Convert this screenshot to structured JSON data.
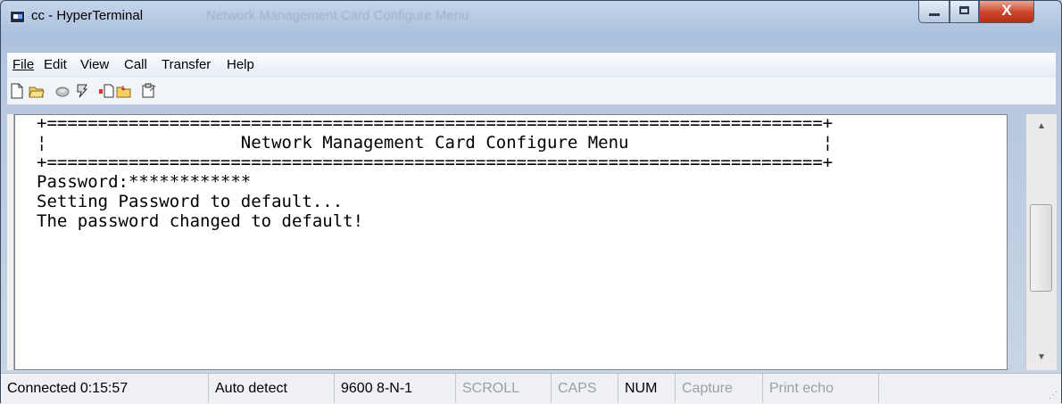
{
  "window": {
    "title": "cc - HyperTerminal",
    "ghost_title": "Network Management Card Configure Menu",
    "close_glyph": "X"
  },
  "menu": [
    "File",
    "Edit",
    "View",
    "Call",
    "Transfer",
    "Help"
  ],
  "toolbar_icons": [
    "new-icon",
    "open-icon",
    "disconnect-icon",
    "dial-icon",
    "send-icon",
    "receive-icon",
    "properties-icon"
  ],
  "terminal": {
    "lines": [
      "+============================================================================+",
      "¦                   Network Management Card Configure Menu                   ¦",
      "+============================================================================+",
      "Password:************",
      "Setting Password to default...",
      "The password changed to default!"
    ]
  },
  "status": {
    "connected": "Connected 0:15:57",
    "detect": "Auto detect",
    "port": "9600 8-N-1",
    "scroll": "SCROLL",
    "caps": "CAPS",
    "num": "NUM",
    "capture": "Capture",
    "print_echo": "Print echo"
  },
  "colors": {
    "accent_close": "#c8452b",
    "terminal_bg": "#ffffff"
  }
}
